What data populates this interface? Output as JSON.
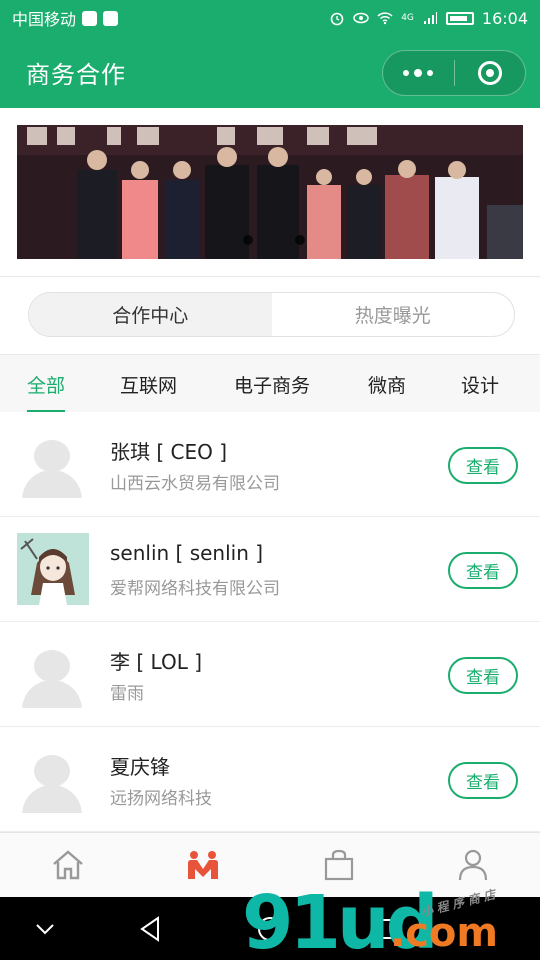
{
  "status_bar": {
    "carrier": "中国移动",
    "network": "4G",
    "time": "16:04"
  },
  "header": {
    "title": "商务合作"
  },
  "segment": {
    "tabs": [
      {
        "label": "合作中心",
        "active": true
      },
      {
        "label": "热度曝光",
        "active": false
      }
    ]
  },
  "categories": [
    {
      "label": "全部",
      "active": true
    },
    {
      "label": "互联网",
      "active": false
    },
    {
      "label": "电子商务",
      "active": false
    },
    {
      "label": "微商",
      "active": false
    },
    {
      "label": "设计",
      "active": false
    }
  ],
  "list": [
    {
      "name": "张琪 [ CEO ]",
      "company": "山西云水贸易有限公司",
      "button": "查看",
      "avatar": "default-avatar-icon"
    },
    {
      "name": "senlin [ senlin ]",
      "company": "爱帮网络科技有限公司",
      "button": "查看",
      "avatar": "anime-girl-photo"
    },
    {
      "name": "李 [ LOL ]",
      "company": "雷雨",
      "button": "查看",
      "avatar": "default-avatar-icon"
    },
    {
      "name": "夏庆锋",
      "company": "远扬网络科技",
      "button": "查看",
      "avatar": "default-avatar-icon"
    }
  ],
  "tabbar": [
    {
      "icon": "home-icon",
      "active": false
    },
    {
      "icon": "cooperation-icon",
      "active": true
    },
    {
      "icon": "shopping-bag-icon",
      "active": false
    },
    {
      "icon": "user-icon",
      "active": false
    }
  ],
  "watermark": {
    "main": "91ud",
    "suffix": ".com",
    "small": "小程序商店"
  },
  "colors": {
    "brand": "#1aad6e",
    "tab_active": "#e8543a"
  }
}
